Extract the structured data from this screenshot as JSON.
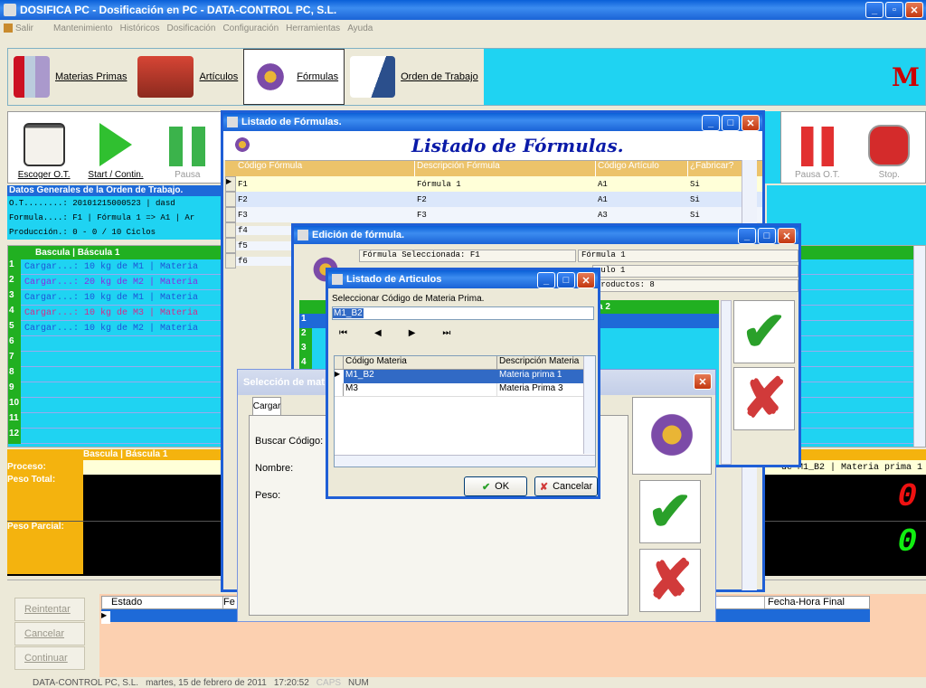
{
  "app": {
    "title": "DOSIFICA PC - Dosificación en PC - DATA-CONTROL PC, S.L.",
    "logo": "M"
  },
  "menu": {
    "salir": "Salir",
    "items": [
      "Mantenimiento",
      "Históricos",
      "Dosificación",
      "Configuración",
      "Herramientas",
      "Ayuda"
    ]
  },
  "toolbar": {
    "materias": "Materias Primas",
    "articulos": "Artículos",
    "formulas": "Fórmulas",
    "orden": "Orden de Trabajo"
  },
  "ot_toolbar": {
    "escoger": "Escoger O.T.",
    "start": "Start / Contin.",
    "pausa": "Pausa",
    "pausa_ot": "Pausa O.T.",
    "stop": "Stop."
  },
  "datos": {
    "header": "Datos Generales de la Orden de Trabajo.",
    "line1": "O.T........: 20101215000523 | dasd",
    "line2": "Formula....: F1 | Fórmula 1 => A1 | Ar",
    "line3": "Producción.: 0 - 0 / 10 Ciclos"
  },
  "bascula": {
    "header": "Bascula | Báscula 1",
    "rows": [
      "1",
      "2",
      "3",
      "4",
      "5",
      "6",
      "7",
      "8",
      "9",
      "10",
      "11",
      "12"
    ],
    "cargas": [
      "Cargar...: 10 kg de M1 | Materia",
      "Cargar...: 20 kg de M2 | Materia",
      "Cargar...: 10 kg de M1 | Materia",
      "Cargar...: 10 kg de M3 | Materia",
      "Cargar...: 10 kg de M2 | Materia"
    ]
  },
  "proceso": {
    "header": "Bascula | Báscula 1",
    "proceso": "Proceso:",
    "peso_total": "Peso Total:",
    "peso_parcial": "Peso Parcial:",
    "right_text": "de M1_B2 | Materia prima 1",
    "total_val": "0",
    "parcial_val": "0"
  },
  "bottom": {
    "reintentar": "Reintentar",
    "cancelar": "Cancelar",
    "continuar": "Continuar",
    "estado": "Estado",
    "fe": "Fe",
    "fecha_final": "Fecha-Hora Final"
  },
  "status": {
    "company": "DATA-CONTROL PC, S.L.",
    "date": "martes, 15 de febrero de 2011",
    "time": "17:20:52",
    "caps": "CAPS",
    "num": "NUM"
  },
  "listado_formulas": {
    "title": "Listado de Fórmulas.",
    "heading": "Listado de Fórmulas.",
    "cols": [
      "Código Fórmula",
      "Descripción Fórmula",
      "Código Artículo",
      "¿Fabricar?"
    ],
    "rows": [
      [
        "F1",
        "Fórmula 1",
        "A1",
        "Si"
      ],
      [
        "F2",
        "F2",
        "A1",
        "Si"
      ],
      [
        "F3",
        "F3",
        "A3",
        "Si"
      ],
      [
        "f4",
        "",
        "",
        " "
      ],
      [
        "f5",
        "",
        "",
        ""
      ],
      [
        "f6",
        "",
        "",
        ""
      ]
    ]
  },
  "edicion": {
    "title": "Edición de fórmula.",
    "sel_label": "Fórmula Seleccionada: F1",
    "formula_name": "Fórmula 1",
    "articulo": "culo 1",
    "productos": "Productos: 8",
    "col": "a 2",
    "rows": [
      "1",
      "2",
      "3",
      "4"
    ]
  },
  "seleccion": {
    "title": "Selección de mat",
    "tab": "Cargar",
    "buscar": "Buscar Código:",
    "nombre": "Nombre:",
    "peso": "Peso:"
  },
  "articulos": {
    "title": "Listado de Articulos",
    "label": "Seleccionar Código de Materia Prima.",
    "value": "M1_B2",
    "cols": [
      "Código Materia",
      "Descripción Materia"
    ],
    "rows": [
      [
        "M1_B2",
        "Materia prima 1"
      ],
      [
        "M3",
        "Materia Prima 3"
      ]
    ],
    "ok": "OK",
    "cancel": "Cancelar"
  }
}
